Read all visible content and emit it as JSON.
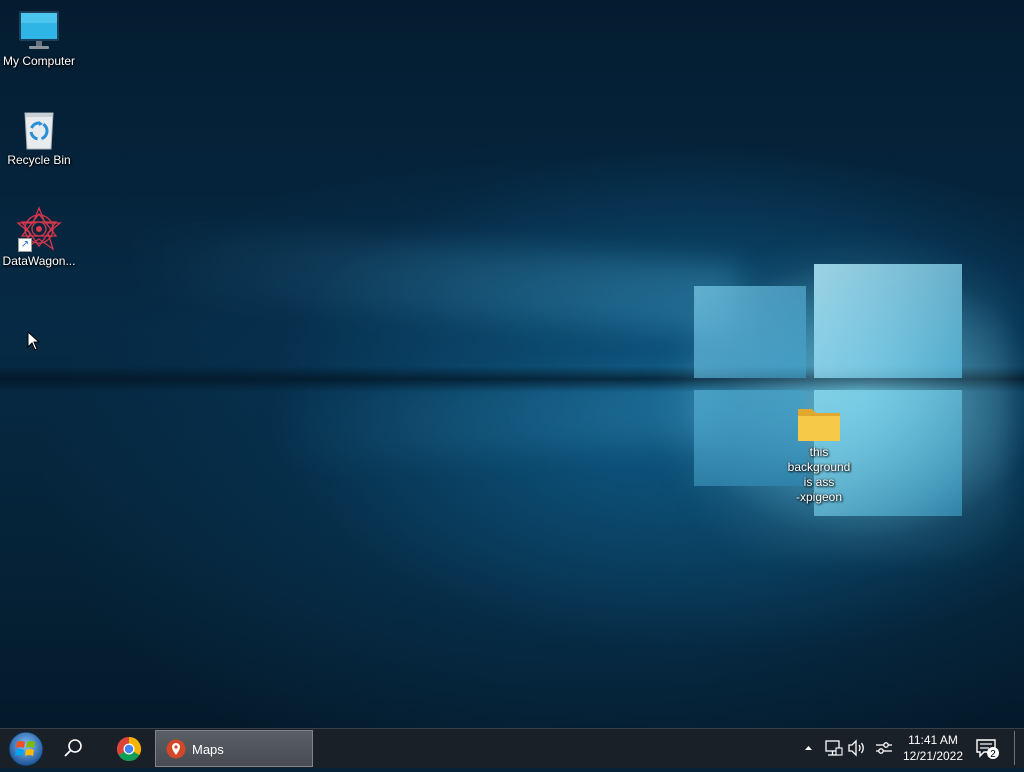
{
  "desktop": {
    "icons": [
      {
        "label": "My Computer",
        "icon": "monitor-icon"
      },
      {
        "label": "Recycle Bin",
        "icon": "recycle-bin-icon"
      },
      {
        "label": "DataWagon...",
        "icon": "datawagon-icon",
        "shortcut": true
      },
      {
        "label": "this background is ass -xpigeon",
        "icon": "folder-icon"
      }
    ],
    "folder_label_lines": [
      "this",
      "background",
      "is ass",
      "-xpigeon"
    ]
  },
  "taskbar": {
    "start": "start-orb-icon",
    "search": "search-icon",
    "pinned": [
      "chrome-icon"
    ],
    "running": [
      {
        "title": "Maps",
        "icon": "maps-pin-icon"
      }
    ],
    "tray_icons": [
      "chevron-up-icon",
      "network-icon",
      "volume-icon",
      "tray-settings-icon"
    ],
    "clock": {
      "time": "11:41 AM",
      "date": "12/21/2022"
    },
    "notifications": {
      "count": "2"
    }
  },
  "colors": {
    "taskbar_bg": "#1a2027",
    "folder": "#f5c542",
    "accent_blue": "#3aa0d8"
  }
}
